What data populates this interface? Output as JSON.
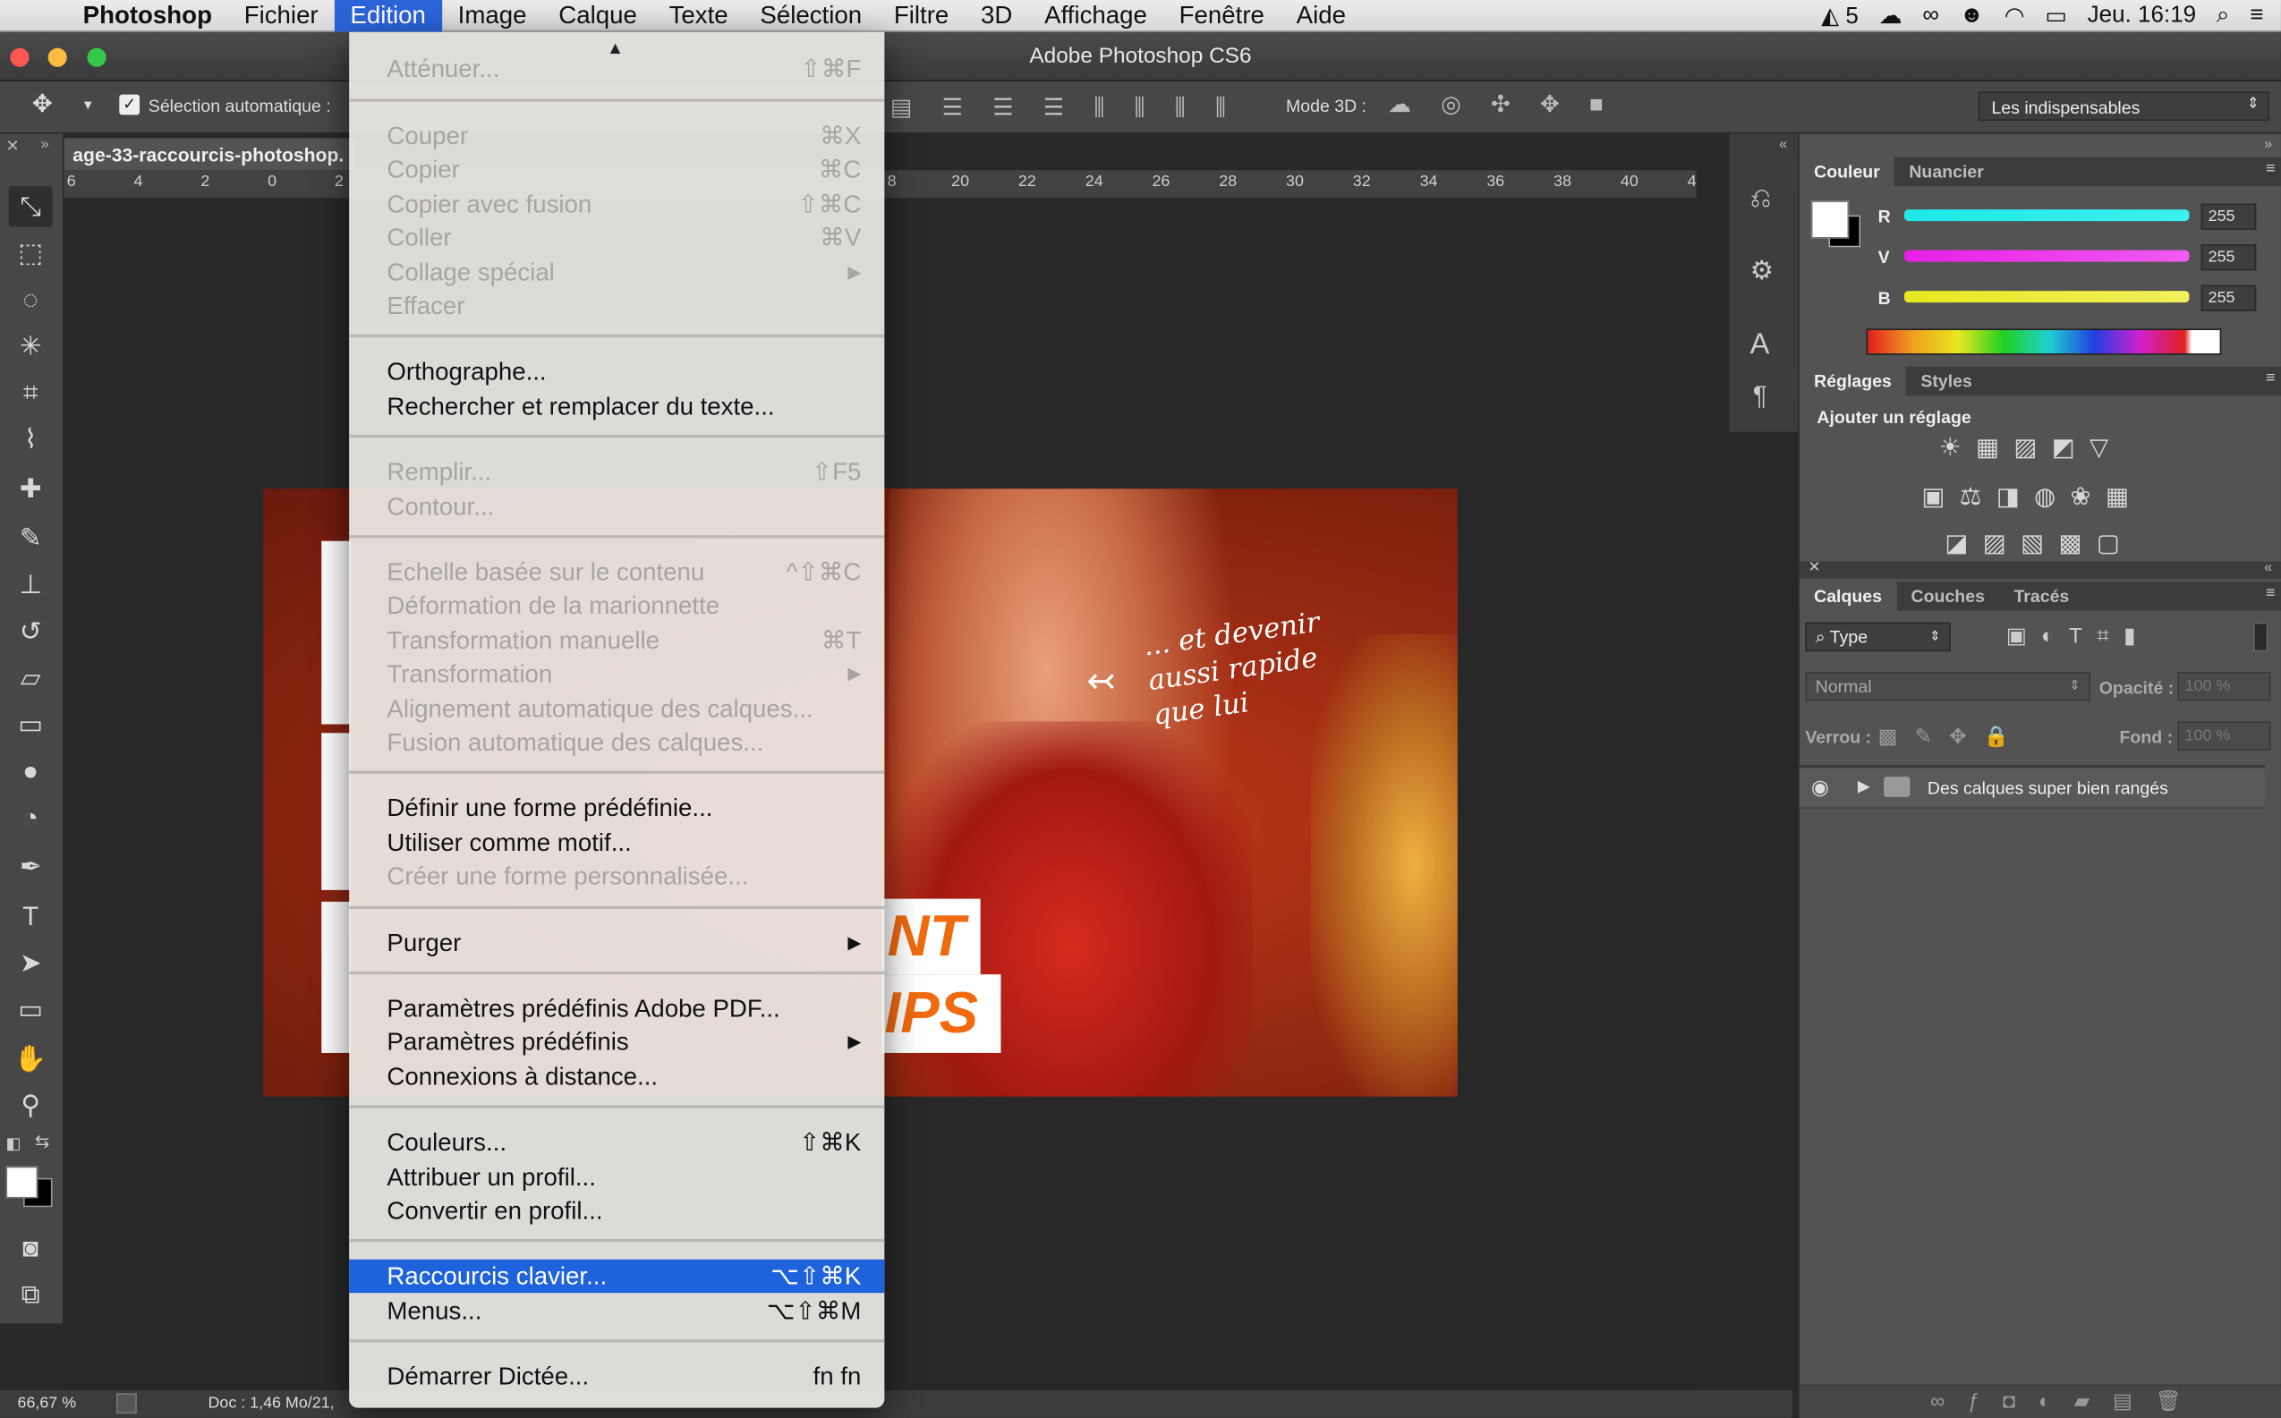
{
  "menubar": {
    "apple": "",
    "items": [
      "Photoshop",
      "Fichier",
      "Edition",
      "Image",
      "Calque",
      "Texte",
      "Sélection",
      "Filtre",
      "3D",
      "Affichage",
      "Fenêtre",
      "Aide"
    ],
    "status_count": "5",
    "clock": "Jeu. 16:19"
  },
  "window": {
    "title": "Adobe Photoshop CS6"
  },
  "options": {
    "auto_select": "Sélection automatique :",
    "mode3d": "Mode 3D :",
    "workspace": "Les indispensables"
  },
  "document": {
    "tab": "age-33-raccourcis-photoshop.",
    "zoom": "66,67 %",
    "doc_info": "Doc : 1,46 Mo/21,"
  },
  "ruler": {
    "labels": [
      "6",
      "4",
      "2",
      "0",
      "2",
      "8",
      "20",
      "22",
      "24",
      "26",
      "28",
      "30",
      "32",
      "34",
      "36",
      "38",
      "40",
      "4"
    ]
  },
  "artwork": {
    "note_line1": "... et devenir",
    "note_line2": "aussi rapide",
    "note_line3": "que lui",
    "big1": "NT",
    "big2": "IPS"
  },
  "color_panel": {
    "tabs": [
      "Couleur",
      "Nuancier"
    ],
    "channels": [
      {
        "label": "R",
        "value": "255"
      },
      {
        "label": "V",
        "value": "255"
      },
      {
        "label": "B",
        "value": "255"
      }
    ]
  },
  "adjust_panel": {
    "tabs": [
      "Réglages",
      "Styles"
    ],
    "heading": "Ajouter un réglage"
  },
  "layers_panel": {
    "tabs": [
      "Calques",
      "Couches",
      "Tracés"
    ],
    "filter": "Type",
    "blend": "Normal",
    "opacity_label": "Opacité :",
    "opacity": "100 %",
    "lock_label": "Verrou :",
    "fill_label": "Fond :",
    "fill": "100 %",
    "layer_name": "Des calques super bien rangés"
  },
  "edit_menu": {
    "first": "Atténuer...",
    "first_sc": "⇧⌘F",
    "groups": [
      [
        {
          "label": "Couper",
          "sc": "⌘X",
          "dis": true
        },
        {
          "label": "Copier",
          "sc": "⌘C",
          "dis": true
        },
        {
          "label": "Copier avec fusion",
          "sc": "⇧⌘C",
          "dis": true
        },
        {
          "label": "Coller",
          "sc": "⌘V",
          "dis": true
        },
        {
          "label": "Collage spécial",
          "sc": "▶",
          "dis": true
        },
        {
          "label": "Effacer",
          "sc": "",
          "dis": true
        }
      ],
      [
        {
          "label": "Orthographe...",
          "sc": "",
          "dis": false
        },
        {
          "label": "Rechercher et remplacer du texte...",
          "sc": "",
          "dis": false
        }
      ],
      [
        {
          "label": "Remplir...",
          "sc": "⇧F5",
          "dis": true
        },
        {
          "label": "Contour...",
          "sc": "",
          "dis": true
        }
      ],
      [
        {
          "label": "Echelle basée sur le contenu",
          "sc": "^⇧⌘C",
          "dis": true
        },
        {
          "label": "Déformation de la marionnette",
          "sc": "",
          "dis": true
        },
        {
          "label": "Transformation manuelle",
          "sc": "⌘T",
          "dis": true
        },
        {
          "label": "Transformation",
          "sc": "▶",
          "dis": true
        },
        {
          "label": "Alignement automatique des calques...",
          "sc": "",
          "dis": true
        },
        {
          "label": "Fusion automatique des calques...",
          "sc": "",
          "dis": true
        }
      ],
      [
        {
          "label": "Définir une forme prédéfinie...",
          "sc": "",
          "dis": false
        },
        {
          "label": "Utiliser comme motif...",
          "sc": "",
          "dis": false
        },
        {
          "label": "Créer une forme personnalisée...",
          "sc": "",
          "dis": true
        }
      ],
      [
        {
          "label": "Purger",
          "sc": "▶",
          "dis": false
        }
      ],
      [
        {
          "label": "Paramètres prédéfinis Adobe PDF...",
          "sc": "",
          "dis": false
        },
        {
          "label": "Paramètres prédéfinis",
          "sc": "▶",
          "dis": false
        },
        {
          "label": "Connexions à distance...",
          "sc": "",
          "dis": false
        }
      ],
      [
        {
          "label": "Couleurs...",
          "sc": "⇧⌘K",
          "dis": false
        },
        {
          "label": "Attribuer un profil...",
          "sc": "",
          "dis": false
        },
        {
          "label": "Convertir en profil...",
          "sc": "",
          "dis": false
        }
      ],
      [
        {
          "label": "Raccourcis clavier...",
          "sc": "⌥⇧⌘K",
          "dis": false,
          "hl": true
        },
        {
          "label": "Menus...",
          "sc": "⌥⇧⌘M",
          "dis": false
        }
      ],
      [
        {
          "label": "Démarrer Dictée...",
          "sc": "fn fn",
          "dis": false
        }
      ]
    ]
  }
}
